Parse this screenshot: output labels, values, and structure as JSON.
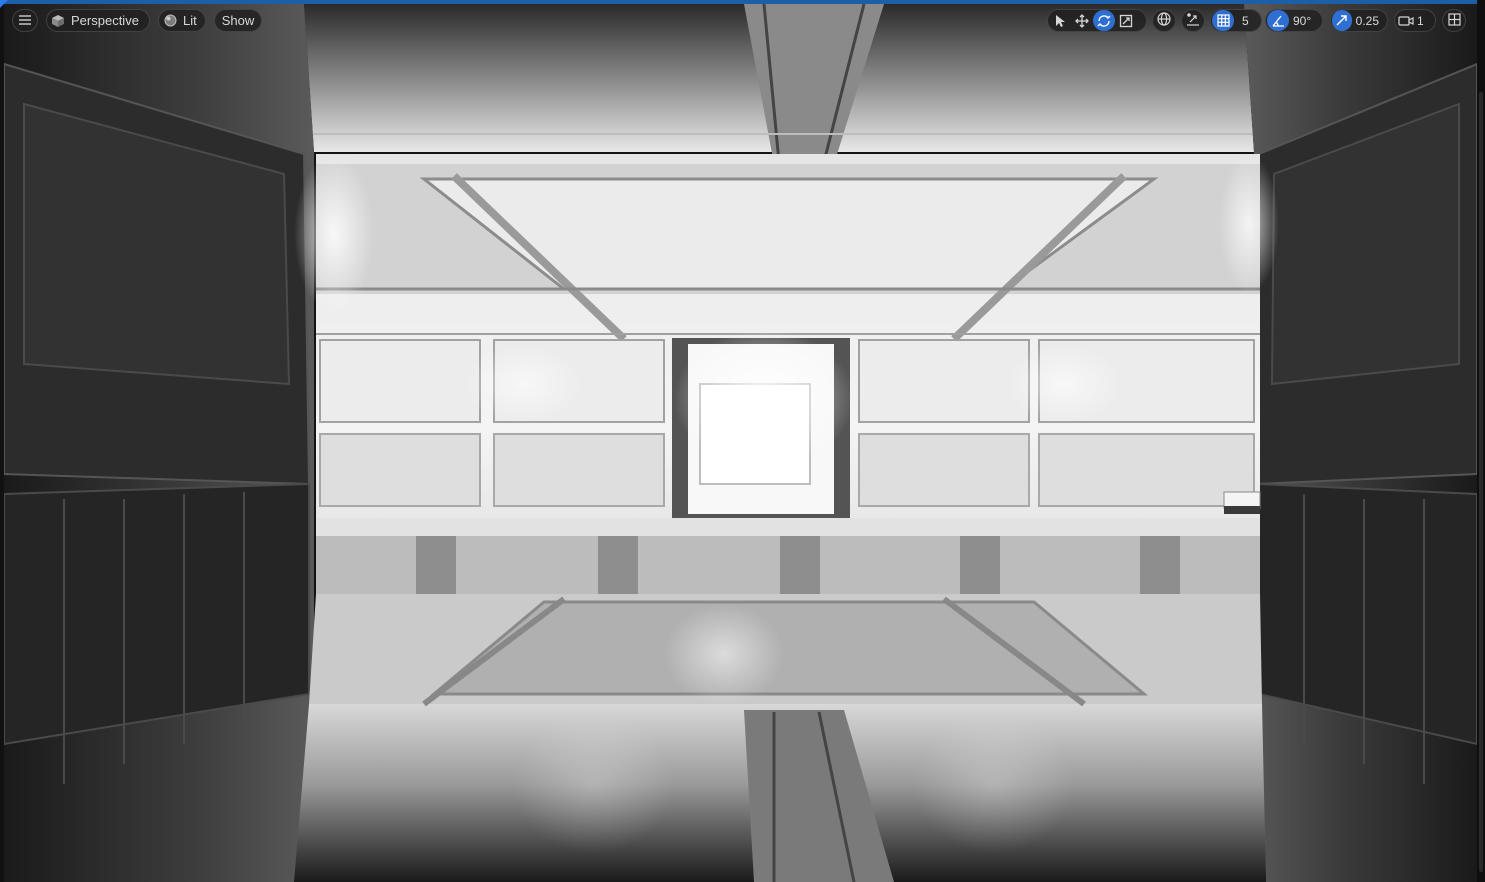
{
  "toolbar": {
    "menu_icon": "hamburger-menu-icon",
    "view_mode": "Perspective",
    "lighting": "Lit",
    "show": "Show",
    "grid_snap": "5",
    "rotation_snap": "90°",
    "scale_snap": "0.25",
    "camera_speed": "1"
  },
  "colors": {
    "accent": "#2f6fd1",
    "toolbar_bg": "#202020",
    "viewport_border": "#1d5ea8"
  },
  "icons": [
    "select-arrow-icon",
    "translate-icon",
    "rotate-icon",
    "scale-icon",
    "world-local-icon",
    "surface-snap-icon",
    "grid-snap-icon",
    "rotation-snap-icon",
    "scale-snap-icon",
    "camera-speed-icon",
    "viewport-layout-icon"
  ]
}
